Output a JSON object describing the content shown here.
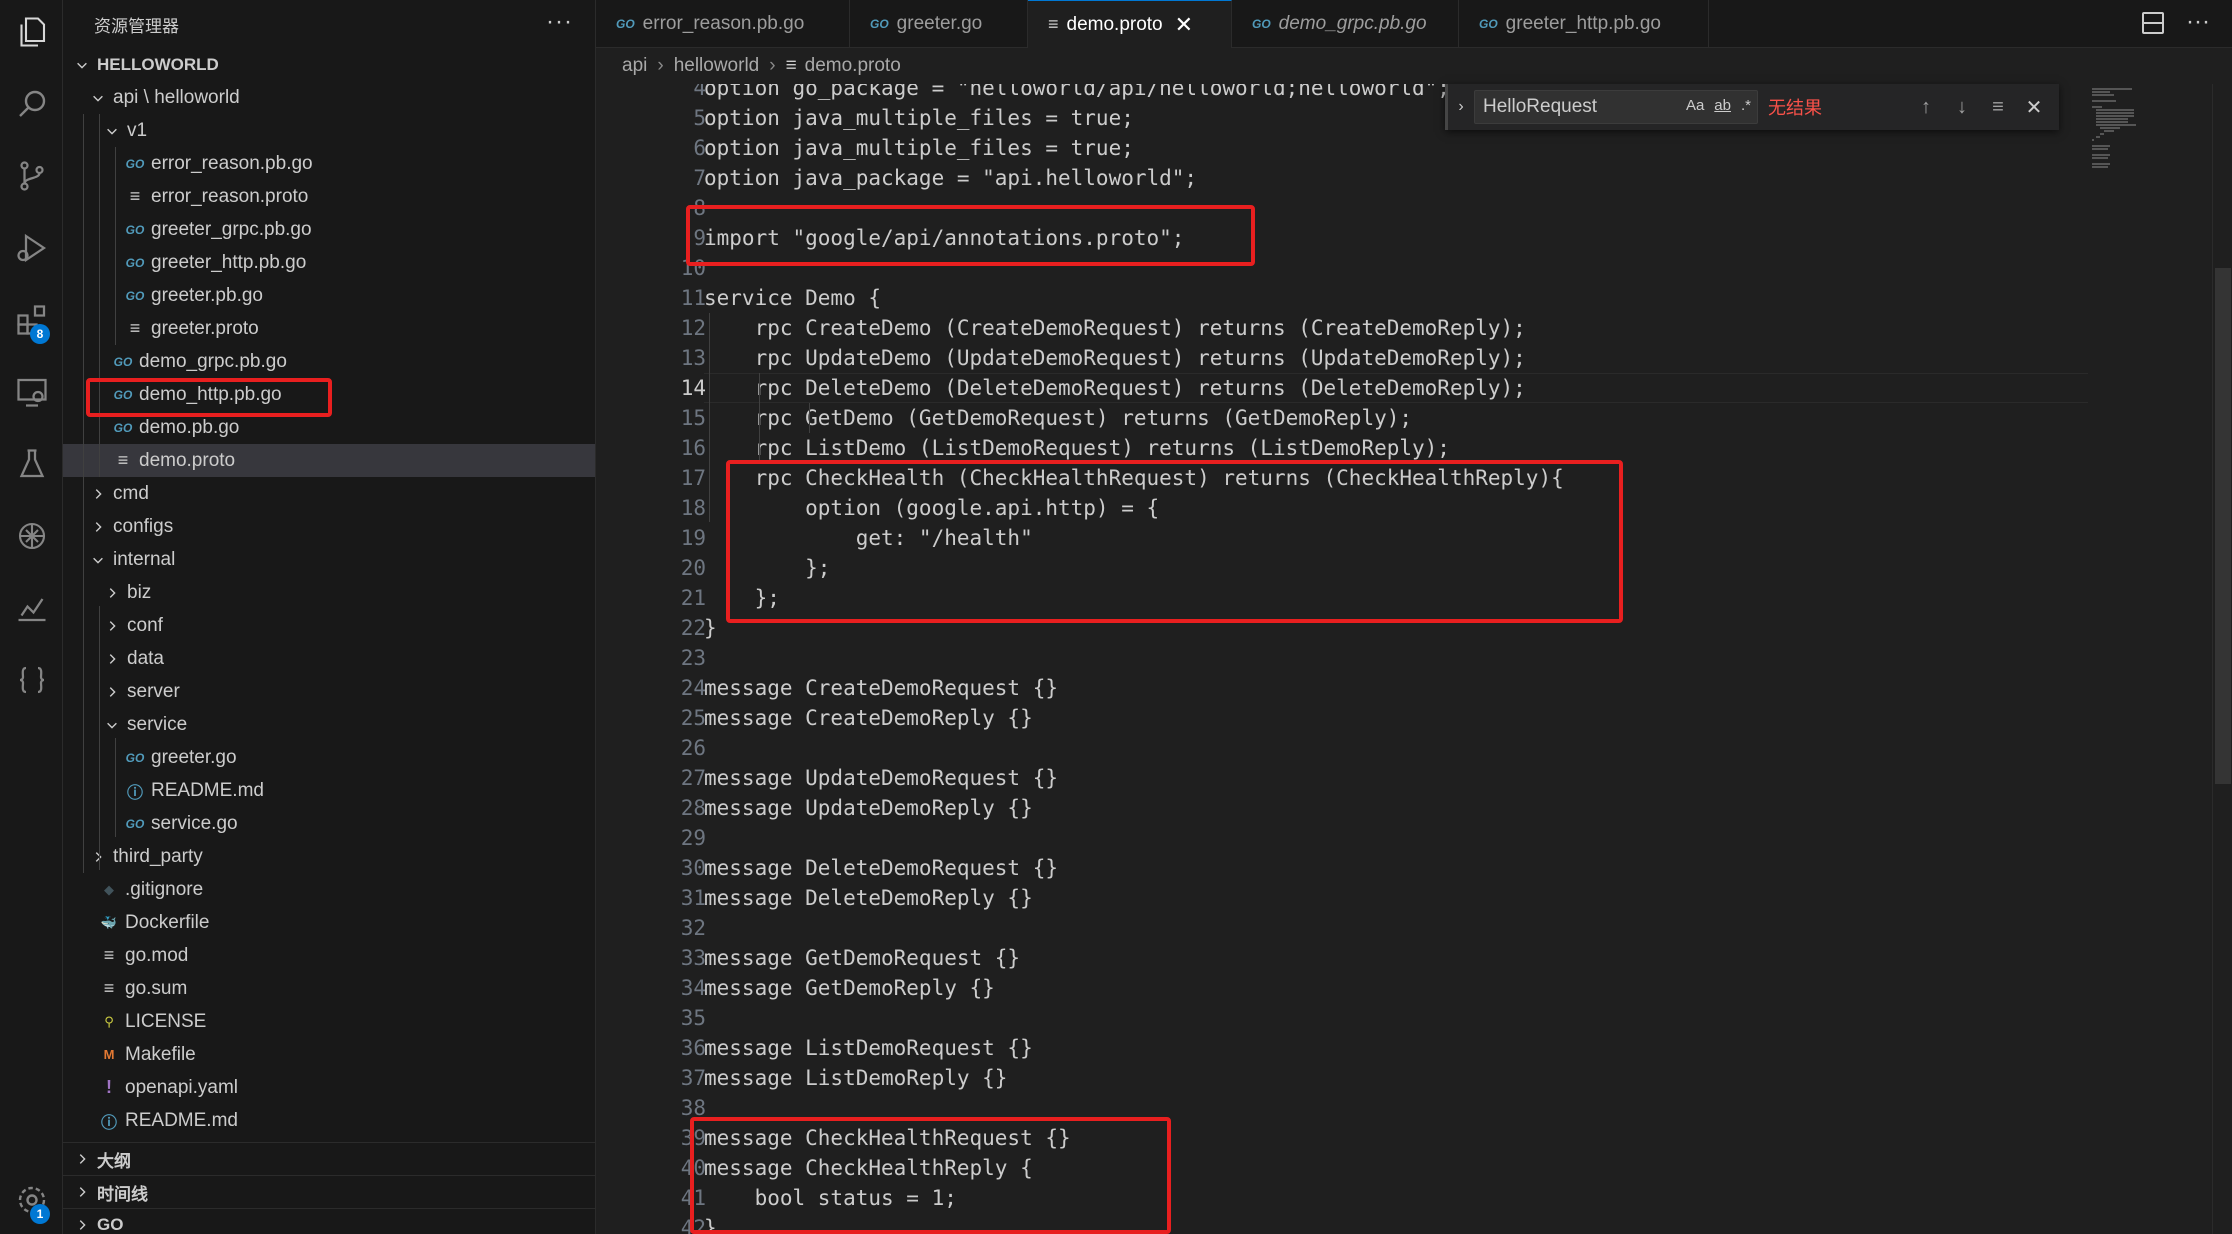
{
  "sidebar": {
    "title": "资源管理器",
    "more": "···",
    "rows": [
      {
        "label": "HELLOWORLD",
        "type": "section",
        "indent": 0,
        "chev": "down"
      },
      {
        "label": "api \\ helloworld",
        "type": "folder",
        "indent": 1,
        "chev": "down"
      },
      {
        "label": "v1",
        "type": "folder",
        "indent": 2,
        "chev": "down"
      },
      {
        "label": "error_reason.pb.go",
        "type": "go",
        "indent": 3
      },
      {
        "label": "error_reason.proto",
        "type": "txt",
        "indent": 3
      },
      {
        "label": "greeter_grpc.pb.go",
        "type": "go",
        "indent": 3
      },
      {
        "label": "greeter_http.pb.go",
        "type": "go",
        "indent": 3
      },
      {
        "label": "greeter.pb.go",
        "type": "go",
        "indent": 3
      },
      {
        "label": "greeter.proto",
        "type": "txt",
        "indent": 3
      },
      {
        "label": "demo_grpc.pb.go",
        "type": "go",
        "indent": 2
      },
      {
        "label": "demo_http.pb.go",
        "type": "go",
        "indent": 2
      },
      {
        "label": "demo.pb.go",
        "type": "go",
        "indent": 2
      },
      {
        "label": "demo.proto",
        "type": "txt",
        "indent": 2,
        "selected": true
      },
      {
        "label": "cmd",
        "type": "folder",
        "indent": 1,
        "chev": "right"
      },
      {
        "label": "configs",
        "type": "folder",
        "indent": 1,
        "chev": "right"
      },
      {
        "label": "internal",
        "type": "folder",
        "indent": 1,
        "chev": "down"
      },
      {
        "label": "biz",
        "type": "folder",
        "indent": 2,
        "chev": "right"
      },
      {
        "label": "conf",
        "type": "folder",
        "indent": 2,
        "chev": "right"
      },
      {
        "label": "data",
        "type": "folder",
        "indent": 2,
        "chev": "right"
      },
      {
        "label": "server",
        "type": "folder",
        "indent": 2,
        "chev": "right"
      },
      {
        "label": "service",
        "type": "folder",
        "indent": 2,
        "chev": "down"
      },
      {
        "label": "greeter.go",
        "type": "go",
        "indent": 3
      },
      {
        "label": "README.md",
        "type": "info",
        "indent": 3
      },
      {
        "label": "service.go",
        "type": "go",
        "indent": 3
      },
      {
        "label": "third_party",
        "type": "folder",
        "indent": 1,
        "chev": "right"
      },
      {
        "label": ".gitignore",
        "type": "git",
        "indent": 1
      },
      {
        "label": "Dockerfile",
        "type": "docker",
        "indent": 1
      },
      {
        "label": "go.mod",
        "type": "txt",
        "indent": 1
      },
      {
        "label": "go.sum",
        "type": "txt",
        "indent": 1
      },
      {
        "label": "LICENSE",
        "type": "lic",
        "indent": 1
      },
      {
        "label": "Makefile",
        "type": "make",
        "indent": 1
      },
      {
        "label": "openapi.yaml",
        "type": "yaml",
        "indent": 1
      },
      {
        "label": "README.md",
        "type": "info",
        "indent": 1
      }
    ],
    "sections": [
      {
        "label": "大纲"
      },
      {
        "label": "时间线"
      },
      {
        "label": "GO"
      }
    ]
  },
  "activity": {
    "extensions_badge": "8",
    "accounts_badge": "1"
  },
  "tabs": [
    {
      "label": "error_reason.pb.go",
      "icon": "GO",
      "active": false,
      "italic": false
    },
    {
      "label": "greeter.go",
      "icon": "GO",
      "active": false,
      "italic": false
    },
    {
      "label": "demo.proto",
      "icon": "≡",
      "active": true,
      "italic": false,
      "close": "✕"
    },
    {
      "label": "demo_grpc.pb.go",
      "icon": "GO",
      "active": false,
      "italic": true
    },
    {
      "label": "greeter_http.pb.go",
      "icon": "GO",
      "active": false,
      "italic": false
    }
  ],
  "tab_more": "···",
  "breadcrumb": {
    "parts": [
      "api",
      "helloworld",
      "demo.proto"
    ],
    "sep": "›",
    "file_icon": "≡"
  },
  "find": {
    "toggle": "›",
    "value": "HelloRequest",
    "opt_case": "Aa",
    "opt_word": "ab",
    "opt_regex": ".*",
    "status": "无结果",
    "prev": "↑",
    "next": "↓",
    "selection": "≡",
    "close": "✕"
  },
  "editor": {
    "current_line": 14,
    "lines": [
      {
        "n": 4,
        "text": "option go_package = \"helloworld/api/helloworld;helloworld\";"
      },
      {
        "n": 5,
        "text": "option java_multiple_files = true;"
      },
      {
        "n": 6,
        "text": "option java_multiple_files = true;"
      },
      {
        "n": 7,
        "text": "option java_package = \"api.helloworld\";"
      },
      {
        "n": 8,
        "text": ""
      },
      {
        "n": 9,
        "text": "import \"google/api/annotations.proto\";"
      },
      {
        "n": 10,
        "text": ""
      },
      {
        "n": 11,
        "text": "service Demo {"
      },
      {
        "n": 12,
        "text": "    rpc CreateDemo (CreateDemoRequest) returns (CreateDemoReply);"
      },
      {
        "n": 13,
        "text": "    rpc UpdateDemo (UpdateDemoRequest) returns (UpdateDemoReply);"
      },
      {
        "n": 14,
        "text": "    rpc DeleteDemo (DeleteDemoRequest) returns (DeleteDemoReply);"
      },
      {
        "n": 15,
        "text": "    rpc GetDemo (GetDemoRequest) returns (GetDemoReply);"
      },
      {
        "n": 16,
        "text": "    rpc ListDemo (ListDemoRequest) returns (ListDemoReply);"
      },
      {
        "n": 17,
        "text": "    rpc CheckHealth (CheckHealthRequest) returns (CheckHealthReply){"
      },
      {
        "n": 18,
        "text": "        option (google.api.http) = {"
      },
      {
        "n": 19,
        "text": "            get: \"/health\""
      },
      {
        "n": 20,
        "text": "        };"
      },
      {
        "n": 21,
        "text": "    };"
      },
      {
        "n": 22,
        "text": "}"
      },
      {
        "n": 23,
        "text": ""
      },
      {
        "n": 24,
        "text": "message CreateDemoRequest {}"
      },
      {
        "n": 25,
        "text": "message CreateDemoReply {}"
      },
      {
        "n": 26,
        "text": ""
      },
      {
        "n": 27,
        "text": "message UpdateDemoRequest {}"
      },
      {
        "n": 28,
        "text": "message UpdateDemoReply {}"
      },
      {
        "n": 29,
        "text": ""
      },
      {
        "n": 30,
        "text": "message DeleteDemoRequest {}"
      },
      {
        "n": 31,
        "text": "message DeleteDemoReply {}"
      },
      {
        "n": 32,
        "text": ""
      },
      {
        "n": 33,
        "text": "message GetDemoRequest {}"
      },
      {
        "n": 34,
        "text": "message GetDemoReply {}"
      },
      {
        "n": 35,
        "text": ""
      },
      {
        "n": 36,
        "text": "message ListDemoRequest {}"
      },
      {
        "n": 37,
        "text": "message ListDemoReply {}"
      },
      {
        "n": 38,
        "text": ""
      },
      {
        "n": 39,
        "text": "message CheckHealthRequest {}"
      },
      {
        "n": 40,
        "text": "message CheckHealthReply {"
      },
      {
        "n": 41,
        "text": "    bool status = 1;"
      },
      {
        "n": 42,
        "text": "}"
      }
    ]
  },
  "colors": {
    "annotation": "#e81f1f",
    "accent": "#0078d4",
    "find_no_result": "#f85149"
  }
}
